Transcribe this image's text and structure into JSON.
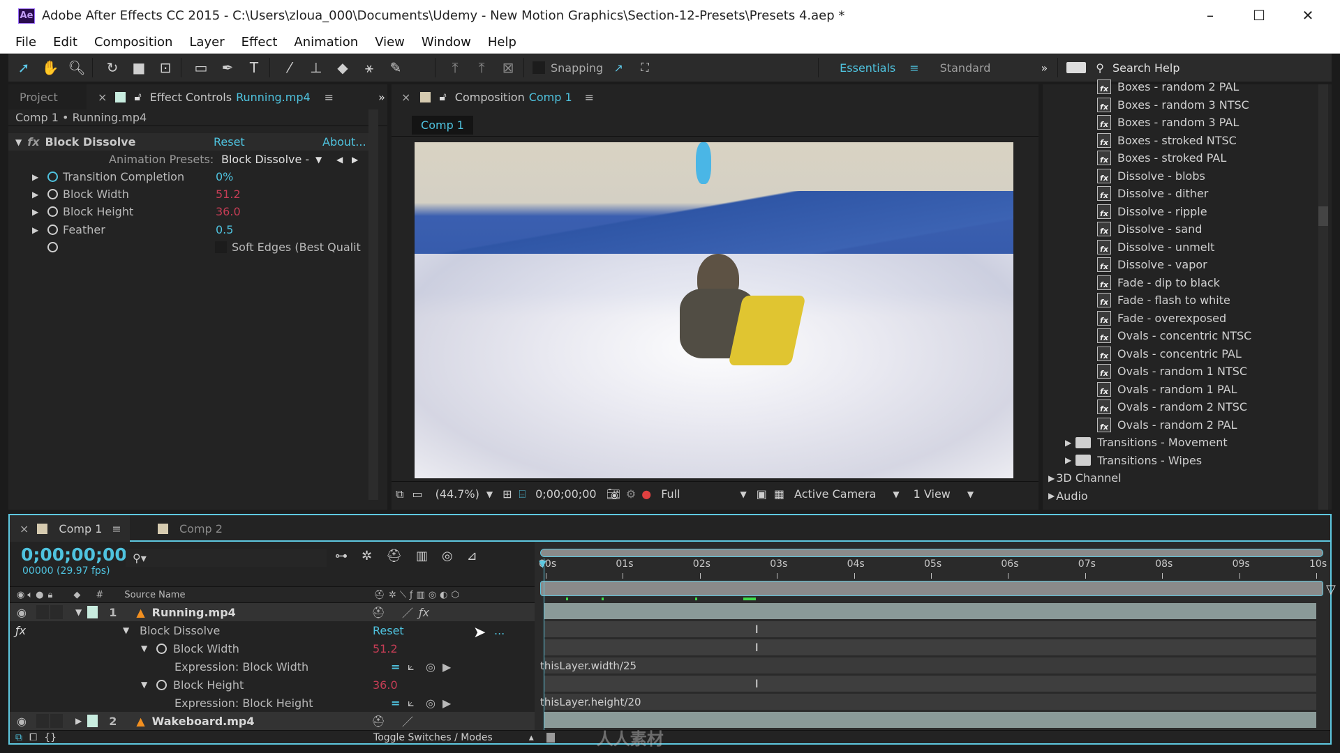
{
  "window": {
    "app_icon": "Ae",
    "title": "Adobe After Effects CC 2015 - C:\\Users\\zloua_000\\Documents\\Udemy - New Motion Graphics\\Section-12-Presets\\Presets 4.aep *",
    "minimize": "–",
    "maximize": "☐",
    "close": "✕"
  },
  "menu": [
    "File",
    "Edit",
    "Composition",
    "Layer",
    "Effect",
    "Animation",
    "View",
    "Window",
    "Help"
  ],
  "toolbar": {
    "snapping_label": "Snapping",
    "workspaces": {
      "active": "Essentials",
      "menu_icon": "≡",
      "other": "Standard",
      "more": "»"
    },
    "search_help": "Search Help"
  },
  "effect_controls": {
    "tab_project": "Project",
    "tab_close": "×",
    "tab_label": "Effect Controls",
    "tab_layer": "Running.mp4",
    "menu_icon": "≡",
    "more": "»",
    "breadcrumb": "Comp 1 • Running.mp4",
    "effect_name": "Block Dissolve",
    "reset": "Reset",
    "about": "About...",
    "presets_label": "Animation Presets:",
    "presets_value": "Block Dissolve -",
    "properties": [
      {
        "name": "Transition Completion",
        "value": "0%",
        "color": "cyan"
      },
      {
        "name": "Block Width",
        "value": "51.2",
        "color": "red"
      },
      {
        "name": "Block Height",
        "value": "36.0",
        "color": "red"
      },
      {
        "name": "Feather",
        "value": "0.5",
        "color": "cyan"
      }
    ],
    "soft_edges_label": "Soft Edges (Best Qualit"
  },
  "composition": {
    "tab_close": "×",
    "tab_label": "Composition",
    "tab_comp": "Comp 1",
    "menu_icon": "≡",
    "subtab": "Comp 1",
    "footer": {
      "zoom": "(44.7%)",
      "timecode": "0;00;00;00",
      "resolution": "Full",
      "camera": "Active Camera",
      "views": "1 View"
    }
  },
  "effects_presets": {
    "items": [
      "Boxes - random 2 PAL",
      "Boxes - random 3 NTSC",
      "Boxes - random 3 PAL",
      "Boxes - stroked NTSC",
      "Boxes - stroked PAL",
      "Dissolve - blobs",
      "Dissolve - dither",
      "Dissolve - ripple",
      "Dissolve - sand",
      "Dissolve - unmelt",
      "Dissolve - vapor",
      "Fade - dip to black",
      "Fade - flash to white",
      "Fade - overexposed",
      "Ovals - concentric NTSC",
      "Ovals - concentric PAL",
      "Ovals - random 1 NTSC",
      "Ovals - random 1 PAL",
      "Ovals - random 2 NTSC",
      "Ovals - random 2 PAL"
    ],
    "folders": [
      "Transitions - Movement",
      "Transitions - Wipes"
    ],
    "categories": [
      "3D Channel",
      "Audio"
    ]
  },
  "timeline": {
    "tabs": [
      {
        "label": "Comp 1",
        "active": true
      },
      {
        "label": "Comp 2",
        "active": false
      }
    ],
    "tab_close": "×",
    "menu_icon": "≡",
    "timecode": "0;00;00;00",
    "frame_info": "00000 (29.97 fps)",
    "column_hash": "#",
    "column_source": "Source Name",
    "ruler": [
      "00s",
      "01s",
      "02s",
      "03s",
      "04s",
      "05s",
      "06s",
      "07s",
      "08s",
      "09s",
      "10s"
    ],
    "layers": [
      {
        "num": "1",
        "name": "Running.mp4"
      },
      {
        "num": "2",
        "name": "Wakeboard.mp4"
      }
    ],
    "effect_group": "Block Dissolve",
    "effect_reset": "Reset",
    "effect_more": "...",
    "props": [
      {
        "name": "Block Width",
        "value": "51.2",
        "expr_label": "Expression: Block Width",
        "expression": "thisLayer.width/25"
      },
      {
        "name": "Block Height",
        "value": "36.0",
        "expr_label": "Expression: Block Height",
        "expression": "thisLayer.height/20"
      }
    ],
    "toggle_label": "Toggle Switches / Modes"
  },
  "watermark": "人人素材"
}
